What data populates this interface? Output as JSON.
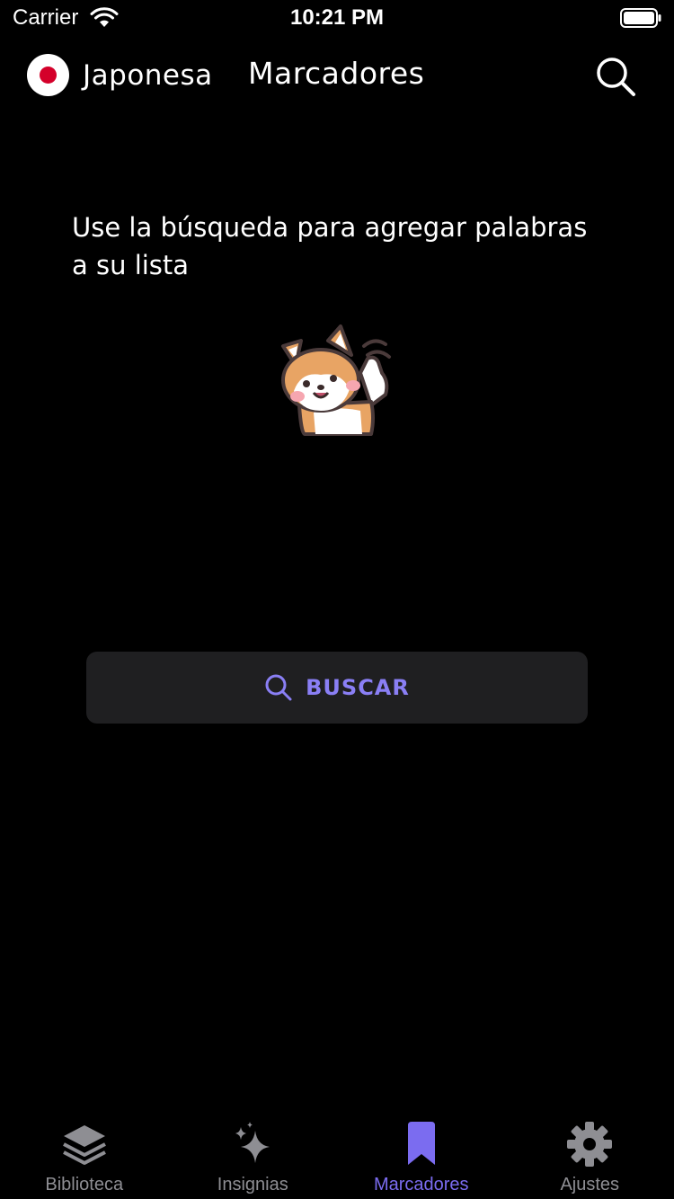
{
  "status_bar": {
    "carrier": "Carrier",
    "time": "10:21 PM"
  },
  "header": {
    "language": "Japonesa",
    "title": "Marcadores"
  },
  "empty_state": {
    "message": "Use la búsqueda para agregar palabras a su lista"
  },
  "search_button": {
    "label": "BUSCAR"
  },
  "tabs": [
    {
      "label": "Biblioteca",
      "icon": "stack-layers-icon"
    },
    {
      "label": "Insignias",
      "icon": "sparkle-icon"
    },
    {
      "label": "Marcadores",
      "icon": "bookmark-icon",
      "active": true
    },
    {
      "label": "Ajustes",
      "icon": "gear-icon"
    }
  ],
  "colors": {
    "background": "#000000",
    "accent": "#7b6cf0",
    "inactive_tab": "#8e8e93",
    "button_bg": "#1f1f21",
    "flag_red": "#d4002a"
  }
}
